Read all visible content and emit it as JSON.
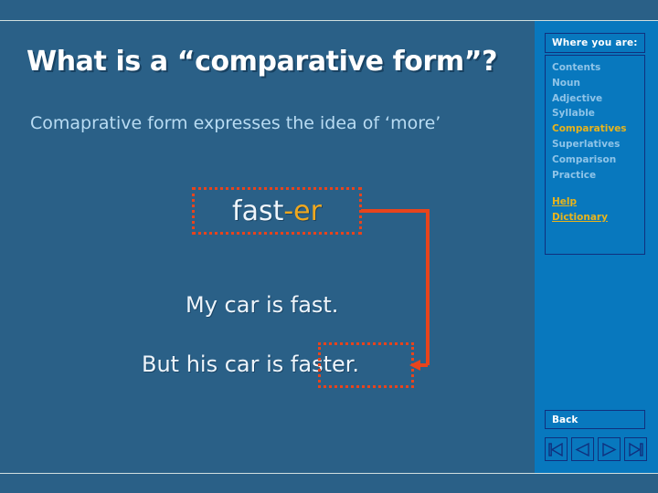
{
  "slide": {
    "title": "What is a “comparative form”?",
    "subtitle": "Comaprative form expresses the idea of ‘more’",
    "word": {
      "stem": "fast",
      "suffix": "-er"
    },
    "sentences": [
      "My car is fast.",
      "But his car is faster."
    ],
    "highlight_color": "#e8441c",
    "suffix_color": "#f0a81e",
    "background_color": "#2a6087"
  },
  "navpanel": {
    "header": "Where you are:",
    "background_color": "#0878be",
    "border_color": "#10307e",
    "toc": [
      {
        "label": "Contents",
        "current": false
      },
      {
        "label": "Noun",
        "current": false
      },
      {
        "label": "Adjective",
        "current": false
      },
      {
        "label": "Syllable",
        "current": false
      },
      {
        "label": "Comparatives",
        "current": true
      },
      {
        "label": "Superlatives",
        "current": false
      },
      {
        "label": "Comparison",
        "current": false
      },
      {
        "label": "Practice",
        "current": false
      }
    ],
    "links": [
      {
        "label": "Help"
      },
      {
        "label": "Dictionary"
      }
    ],
    "back_label": "Back",
    "buttons": [
      {
        "name": "first-slide-button",
        "icon": "first-icon"
      },
      {
        "name": "previous-slide-button",
        "icon": "previous-icon"
      },
      {
        "name": "next-slide-button",
        "icon": "next-icon"
      },
      {
        "name": "last-slide-button",
        "icon": "last-icon"
      }
    ],
    "link_color": "#e8b41c",
    "toc_color": "#8fc4e8"
  }
}
